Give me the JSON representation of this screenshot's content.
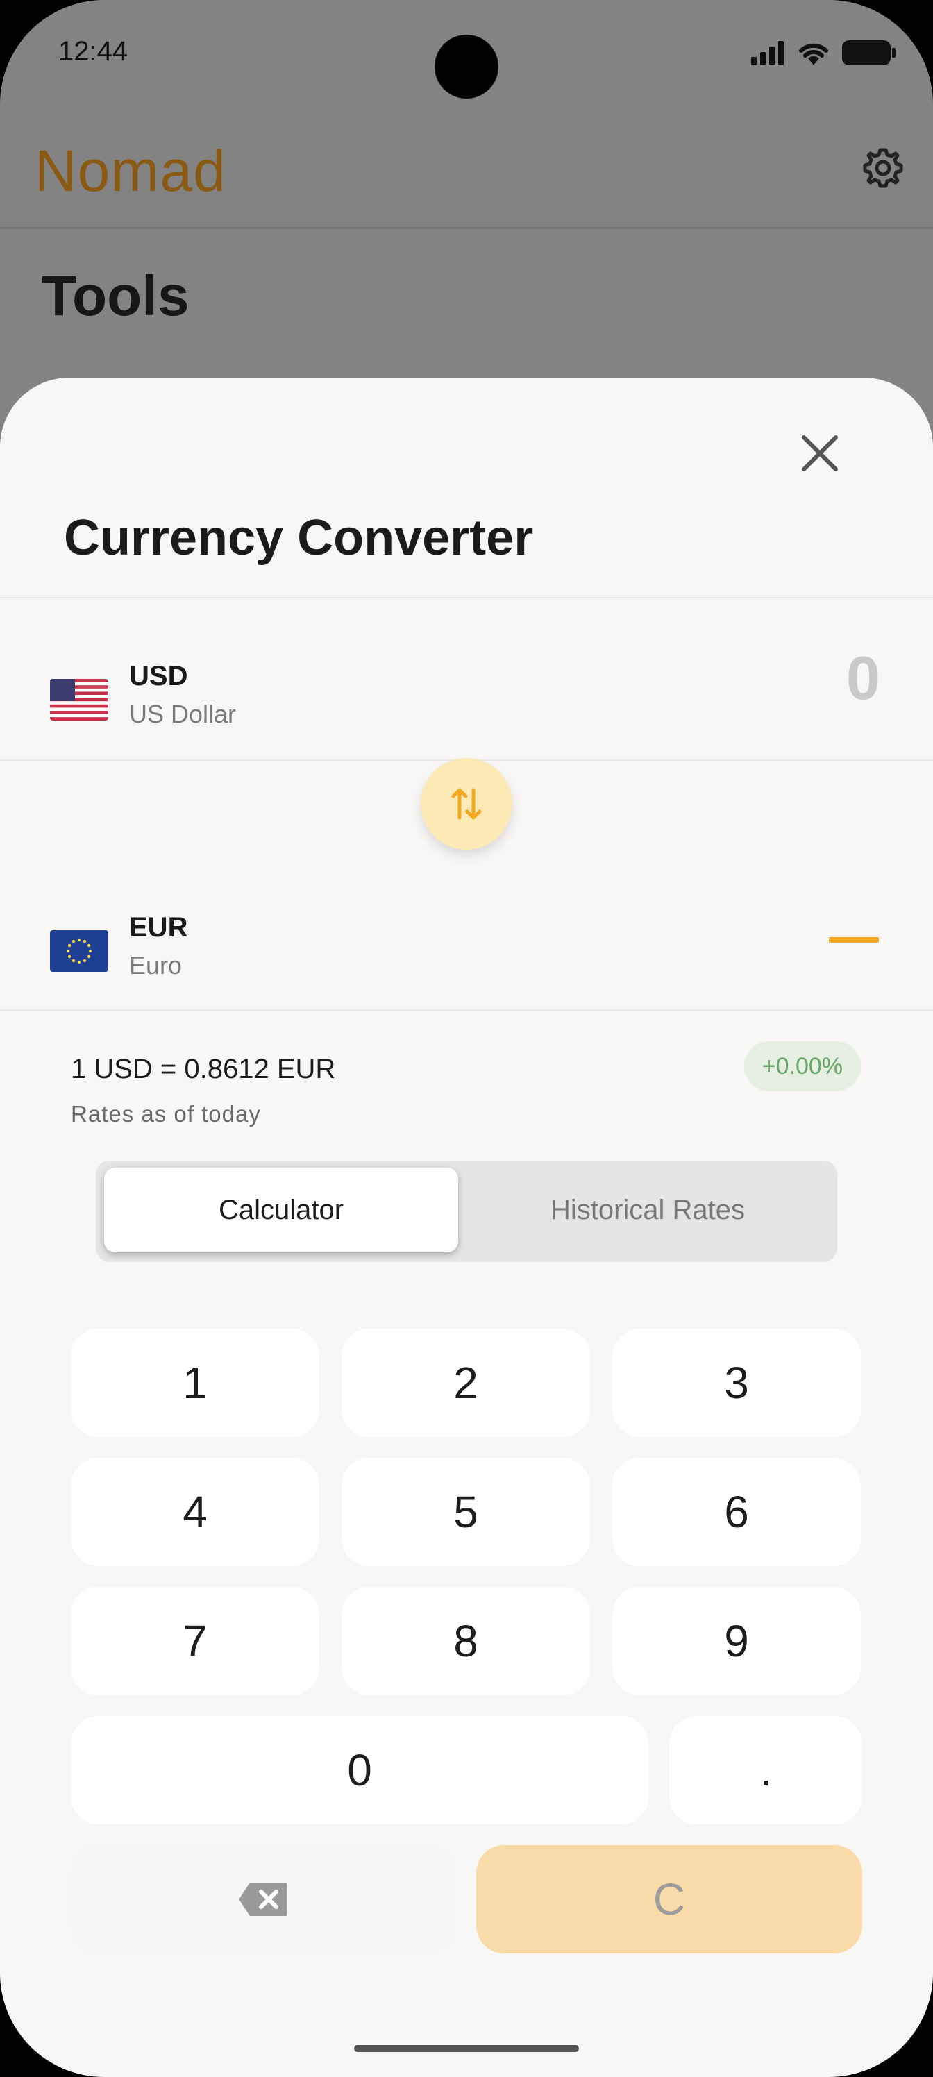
{
  "status_bar": {
    "time": "12:44"
  },
  "app": {
    "brand": "Nomad",
    "page_title": "Tools"
  },
  "sheet": {
    "title": "Currency Converter",
    "from": {
      "code": "USD",
      "name": "US Dollar",
      "amount": "0"
    },
    "to": {
      "code": "EUR",
      "name": "Euro"
    },
    "rate": {
      "text": "1 USD = 0.8612 EUR",
      "subtitle": "Rates as of today",
      "change": "+0.00%"
    },
    "tabs": {
      "calculator": "Calculator",
      "historical": "Historical Rates",
      "selected": "Calculator"
    },
    "keypad": {
      "k1": "1",
      "k2": "2",
      "k3": "3",
      "k4": "4",
      "k5": "5",
      "k6": "6",
      "k7": "7",
      "k8": "8",
      "k9": "9",
      "k0": "0",
      "dot": ".",
      "clear": "C"
    }
  },
  "colors": {
    "accent": "#f3a91f",
    "brand": "#8a5a14",
    "swap_bg": "#fde9b6",
    "clear_bg": "#f8dba9",
    "positive": "#6aa76a"
  },
  "icons": [
    "signal-icon",
    "wifi-icon",
    "battery-icon",
    "gear-icon",
    "close-icon",
    "us-flag-icon",
    "eu-flag-icon",
    "swap-icon",
    "backspace-icon"
  ]
}
